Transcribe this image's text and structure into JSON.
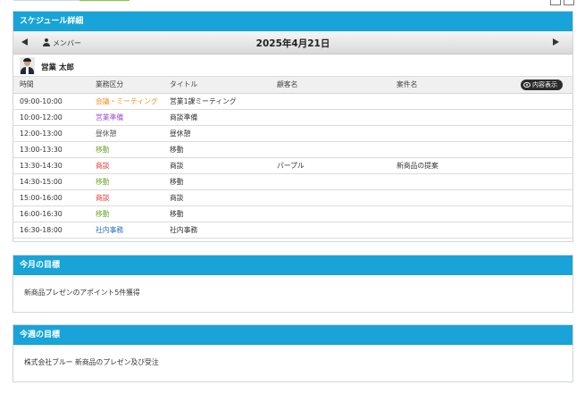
{
  "colors": {
    "header_bg": "#18a4d8",
    "category": {
      "meeting": "#f08c19",
      "prep": "#9c4fd6",
      "break": "#555555",
      "travel": "#6aab2e",
      "negotiation": "#e53935",
      "office": "#2b6fc4"
    }
  },
  "toolbar_icons": [
    "print-icon",
    "export-icon"
  ],
  "schedule": {
    "header_title": "スケジュール詳細",
    "member_label": "メンバー",
    "date": "2025年4月21日",
    "user_name": "営業 太郎",
    "columns": [
      "時間",
      "業務区分",
      "タイトル",
      "顧客名",
      "案件名"
    ],
    "detail_button_label": "内容表示",
    "rows": [
      {
        "time": "09:00-10:00",
        "category": "会議・ミーティング",
        "category_type": "meeting",
        "title": "営業1課ミーティング",
        "customer": "",
        "project": ""
      },
      {
        "time": "10:00-12:00",
        "category": "営業準備",
        "category_type": "prep",
        "title": "商談準備",
        "customer": "",
        "project": ""
      },
      {
        "time": "12:00-13:00",
        "category": "昼休憩",
        "category_type": "break",
        "title": "昼休憩",
        "customer": "",
        "project": ""
      },
      {
        "time": "13:00-13:30",
        "category": "移動",
        "category_type": "travel",
        "title": "移動",
        "customer": "",
        "project": ""
      },
      {
        "time": "13:30-14:30",
        "category": "商談",
        "category_type": "negotiation",
        "title": "商談",
        "customer": "パープル",
        "project": "新商品の提案"
      },
      {
        "time": "14:30-15:00",
        "category": "移動",
        "category_type": "travel",
        "title": "移動",
        "customer": "",
        "project": ""
      },
      {
        "time": "15:00-16:00",
        "category": "商談",
        "category_type": "negotiation",
        "title": "商談",
        "customer": "",
        "project": ""
      },
      {
        "time": "16:00-16:30",
        "category": "移動",
        "category_type": "travel",
        "title": "移動",
        "customer": "",
        "project": ""
      },
      {
        "time": "16:30-18:00",
        "category": "社内事務",
        "category_type": "office",
        "title": "社内事務",
        "customer": "",
        "project": ""
      }
    ]
  },
  "monthly_goal": {
    "header_title": "今月の目標",
    "text": "新商品プレゼンのアポイント5件獲得"
  },
  "weekly_goal": {
    "header_title": "今週の目標",
    "text": "株式会社ブルー 新商品のプレゼン及び受注"
  }
}
